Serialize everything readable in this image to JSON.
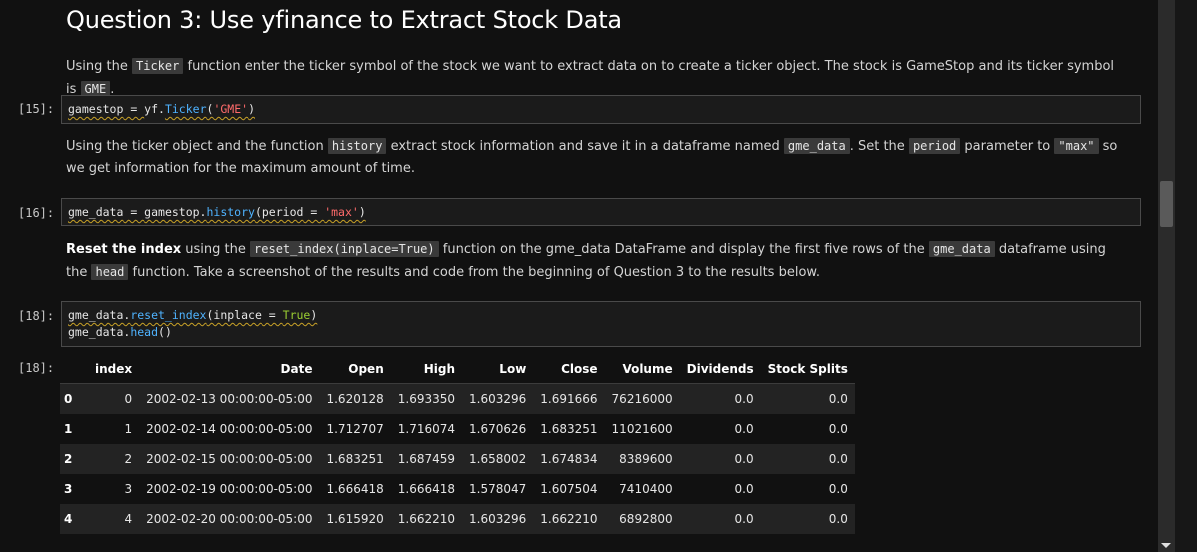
{
  "heading": "Question 3: Use yfinance to Extract Stock Data",
  "md1": {
    "t1": "Using the ",
    "c1": "Ticker",
    "t2": " function enter the ticker symbol of the stock we want to extract data on to create a ticker object. The stock is GameStop and its ticker symbol is ",
    "c2": "GME",
    "t3": "."
  },
  "cell15": {
    "prompt": "[15]:",
    "var": "gamestop",
    "eq": " = ",
    "obj": "yf.",
    "fn": "Ticker",
    "open": "(",
    "str": "'GME'",
    "close": ")"
  },
  "md2": {
    "t1": "Using the ticker object and the function ",
    "c1": "history",
    "t2": " extract stock information and save it in a dataframe named ",
    "c2": "gme_data",
    "t3": ". Set the ",
    "c3": "period",
    "t4": " parameter to ",
    "c4": "\"max\"",
    "t5": " so we get information for the maximum amount of time."
  },
  "cell16": {
    "prompt": "[16]:",
    "var": "gme_data",
    "eq": " = ",
    "obj": "gamestop.",
    "fn": "history",
    "open": "(period",
    "eq2": " = ",
    "str": "'max'",
    "close": ")"
  },
  "md3": {
    "b1": "Reset the index",
    "t1": " using the ",
    "c1": "reset_index(inplace=True)",
    "t2": " function on the gme_data DataFrame and display the first five rows of the ",
    "c2": "gme_data",
    "t3": " dataframe using the ",
    "c3": "head",
    "t4": " function. Take a screenshot of the results and code from the beginning of Question 3 to the results below."
  },
  "cell18": {
    "prompt": "[18]:",
    "l1_obj": "gme_data.",
    "l1_fn": "reset_index",
    "l1_open": "(inplace",
    "l1_eq": " = ",
    "l1_kw": "True",
    "l1_close": ")",
    "l2_obj": "gme_data.",
    "l2_fn": "head",
    "l2_call": "()"
  },
  "output18": {
    "prompt": "[18]:",
    "columns": [
      "",
      "index",
      "Date",
      "Open",
      "High",
      "Low",
      "Close",
      "Volume",
      "Dividends",
      "Stock Splits"
    ],
    "rows": [
      [
        "0",
        "0",
        "2002-02-13 00:00:00-05:00",
        "1.620128",
        "1.693350",
        "1.603296",
        "1.691666",
        "76216000",
        "0.0",
        "0.0"
      ],
      [
        "1",
        "1",
        "2002-02-14 00:00:00-05:00",
        "1.712707",
        "1.716074",
        "1.670626",
        "1.683251",
        "11021600",
        "0.0",
        "0.0"
      ],
      [
        "2",
        "2",
        "2002-02-15 00:00:00-05:00",
        "1.683251",
        "1.687459",
        "1.658002",
        "1.674834",
        "8389600",
        "0.0",
        "0.0"
      ],
      [
        "3",
        "3",
        "2002-02-19 00:00:00-05:00",
        "1.666418",
        "1.666418",
        "1.578047",
        "1.607504",
        "7410400",
        "0.0",
        "0.0"
      ],
      [
        "4",
        "4",
        "2002-02-20 00:00:00-05:00",
        "1.615920",
        "1.662210",
        "1.603296",
        "1.662210",
        "6892800",
        "0.0",
        "0.0"
      ]
    ]
  }
}
